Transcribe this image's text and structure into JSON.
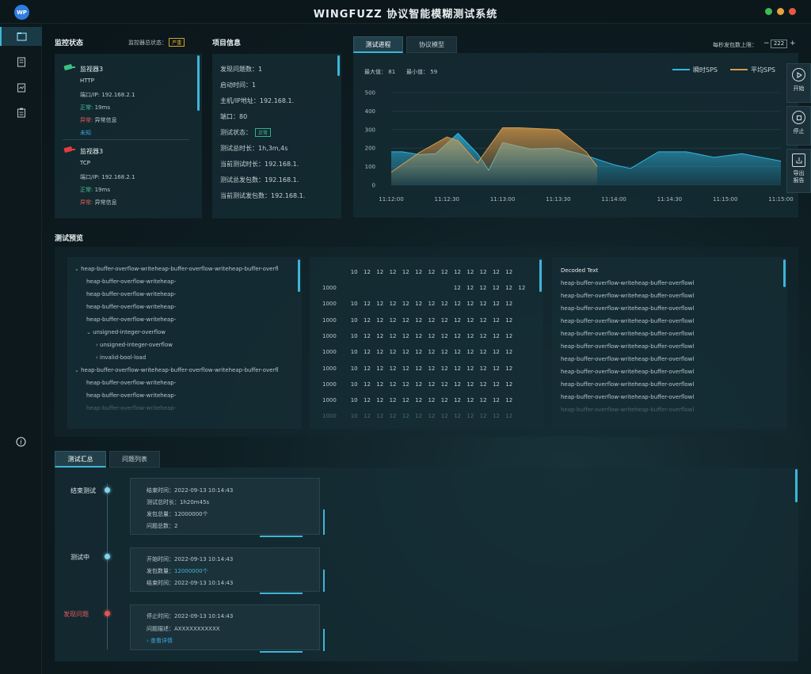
{
  "app": {
    "logo": "WP",
    "title": "WINGFUZZ 协议智能模糊测试系统"
  },
  "monitor": {
    "title": "监控状态",
    "total_status_label": "监控器总状态：",
    "total_status_badge": "严重",
    "items": [
      {
        "name": "监视器3",
        "protocol": "HTTP",
        "addr_label": "端口/IP:",
        "addr": "192.168.2.1",
        "normal_label": "正常:",
        "normal_value": "19ms",
        "error_label": "异常:",
        "error_value": "异常信息",
        "unknown": "未知",
        "icon_color": "#3fbf7f"
      },
      {
        "name": "监视器3",
        "protocol": "TCP",
        "addr_label": "端口/IP:",
        "addr": "192.168.2.1",
        "normal_label": "正常:",
        "normal_value": "19ms",
        "error_label": "异常:",
        "error_value": "异常信息",
        "icon_color": "#e03d3d"
      }
    ]
  },
  "project": {
    "title": "项目信息",
    "rows": [
      "发现问题数：1",
      "启动时间：1",
      "主机/IP地址：192.168.1.",
      "端口：80",
      "测试状态：",
      "测试总时长：1h,3m,4s",
      "当前测试时长：192.168.1.",
      "测试总发包数：192.168.1.",
      "当前测试发包数：192.168.1."
    ],
    "status_badge": "正常"
  },
  "chart_tabs": {
    "progress": "测试进程",
    "model": "协议模型",
    "limit_label": "每秒发包数上限：",
    "limit_value": "222",
    "minus": "−",
    "plus": "+"
  },
  "chart_data": {
    "type": "area",
    "max_label": "最大值：",
    "max_value": "81",
    "min_label": "最小值：",
    "min_value": "59",
    "x": [
      "11:12:00",
      "11:12:30",
      "11:13:00",
      "11:13:30",
      "11:14:00",
      "11:14:30",
      "11:15:00",
      "11:15:00"
    ],
    "ylim": [
      0,
      500
    ],
    "yticks": [
      "500",
      "400",
      "300",
      "200",
      "100",
      "0"
    ],
    "grid": true,
    "legend_position": "top-right",
    "series": [
      {
        "name": "瞬时SPS",
        "color": "#2fb6e0",
        "x": [
          0,
          0.2,
          0.5,
          0.8,
          1.2,
          1.55,
          1.75,
          2,
          2.5,
          3,
          3.5,
          4,
          4.3,
          4.8,
          5.3,
          5.8,
          6.3,
          7
        ],
        "values": [
          180,
          180,
          165,
          170,
          280,
          170,
          80,
          230,
          195,
          200,
          160,
          110,
          90,
          180,
          180,
          150,
          170,
          130
        ]
      },
      {
        "name": "平均SPS",
        "color": "#d99a4a",
        "x": [
          0,
          0.5,
          1,
          1.2,
          1.55,
          2,
          2.3,
          3,
          3.5,
          3.7
        ],
        "values": [
          70,
          175,
          260,
          240,
          120,
          310,
          310,
          300,
          180,
          100
        ]
      }
    ]
  },
  "preview": {
    "title": "测试预览",
    "tree": [
      {
        "text": "heap-buffer-overflow-writeheap-buffer-overflow-writeheap-buffer-overfl",
        "indent": 0,
        "arrow": "v"
      },
      {
        "text": "heap-buffer-overflow-writeheap-",
        "indent": 1,
        "arrow": ""
      },
      {
        "text": "heap-buffer-overflow-writeheap-",
        "indent": 1,
        "arrow": ""
      },
      {
        "text": "heap-buffer-overflow-writeheap-",
        "indent": 1,
        "arrow": ""
      },
      {
        "text": "heap-buffer-overflow-writeheap-",
        "indent": 1,
        "arrow": ""
      },
      {
        "text": "unsigned-integer-overflow",
        "indent": 1,
        "arrow": "v"
      },
      {
        "text": "unsigned-integer-overflow",
        "indent": 2,
        "arrow": ">"
      },
      {
        "text": "invalid-bool-load",
        "indent": 2,
        "arrow": ">"
      },
      {
        "text": "heap-buffer-overflow-writeheap-buffer-overflow-writeheap-buffer-overfl",
        "indent": 0,
        "arrow": "v"
      },
      {
        "text": "heap-buffer-overflow-writeheap-",
        "indent": 1,
        "arrow": ""
      },
      {
        "text": "heap-buffer-overflow-writeheap-",
        "indent": 1,
        "arrow": ""
      },
      {
        "text": "heap-buffer-overflow-writeheap-",
        "indent": 1,
        "arrow": ""
      }
    ],
    "hex_header": [
      "10",
      "12",
      "12",
      "12",
      "12",
      "12",
      "12",
      "12",
      "12",
      "12",
      "12",
      "12",
      "12"
    ],
    "hex_rows": [
      {
        "offset": "1000",
        "cells": [
          "",
          "",
          "",
          "",
          "12",
          "12",
          "12",
          "12",
          "12",
          "12"
        ]
      },
      {
        "offset": "1000",
        "cells": [
          "10",
          "12",
          "12",
          "12",
          "12",
          "12",
          "12",
          "12",
          "12",
          "12",
          "12",
          "12",
          "12"
        ]
      },
      {
        "offset": "1000",
        "cells": [
          "10",
          "12",
          "12",
          "12",
          "12",
          "12",
          "12",
          "12",
          "12",
          "12",
          "12",
          "12",
          "12"
        ]
      },
      {
        "offset": "1000",
        "cells": [
          "10",
          "12",
          "12",
          "12",
          "12",
          "12",
          "12",
          "12",
          "12",
          "12",
          "12",
          "12",
          "12"
        ]
      },
      {
        "offset": "1000",
        "cells": [
          "10",
          "12",
          "12",
          "12",
          "12",
          "12",
          "12",
          "12",
          "12",
          "12",
          "12",
          "12",
          "12"
        ]
      },
      {
        "offset": "1000",
        "cells": [
          "10",
          "12",
          "12",
          "12",
          "12",
          "12",
          "12",
          "12",
          "12",
          "12",
          "12",
          "12",
          "12"
        ]
      },
      {
        "offset": "1000",
        "cells": [
          "10",
          "12",
          "12",
          "12",
          "12",
          "12",
          "12",
          "12",
          "12",
          "12",
          "12",
          "12",
          "12"
        ]
      },
      {
        "offset": "1000",
        "cells": [
          "10",
          "12",
          "12",
          "12",
          "12",
          "12",
          "12",
          "12",
          "12",
          "12",
          "12",
          "12",
          "12"
        ]
      },
      {
        "offset": "1000",
        "cells": [
          "10",
          "12",
          "12",
          "12",
          "12",
          "12",
          "12",
          "12",
          "12",
          "12",
          "12",
          "12",
          "12"
        ]
      }
    ],
    "decoded_title": "Decoded Text",
    "decoded_rows": [
      "heap-buffer-overflow-writeheap-buffer-overflowl",
      "heap-buffer-overflow-writeheap-buffer-overflowl",
      "heap-buffer-overflow-writeheap-buffer-overflowl",
      "heap-buffer-overflow-writeheap-buffer-overflowl",
      "heap-buffer-overflow-writeheap-buffer-overflowl",
      "heap-buffer-overflow-writeheap-buffer-overflowl",
      "heap-buffer-overflow-writeheap-buffer-overflowl",
      "heap-buffer-overflow-writeheap-buffer-overflowl",
      "heap-buffer-overflow-writeheap-buffer-overflowl",
      "heap-buffer-overflow-writeheap-buffer-overflowl",
      "heap-buffer-overflow-writeheap-buffer-overflowl"
    ]
  },
  "summary_tabs": {
    "summary": "测试汇总",
    "issues": "问题列表"
  },
  "timeline": [
    {
      "label": "结束测试",
      "dot": "#7fd4ea",
      "label_color": "#dfe8eb",
      "rows": [
        "结束时间：2022-09-13 10:14:43",
        "测试总时长：1h20m45s",
        "发包总量：12000000个",
        "问题总数：2"
      ]
    },
    {
      "label": "测试中",
      "dot": "#7fd4ea",
      "label_color": "#dfe8eb",
      "rows": [
        "开始时间：2022-09-13 10:14:43",
        "发包数量：",
        "结束时间：2022-09-13 10:14:43"
      ],
      "highlight": "12000000个"
    },
    {
      "label": "发现问题",
      "dot": "#e05555",
      "label_color": "#e25b5b",
      "rows": [
        "停止时间：2022-09-13 10:14:43",
        "问题描述：AXXXXXXXXXXX"
      ],
      "link": "查看详情"
    }
  ],
  "actions": {
    "start": "开始",
    "stop": "停止",
    "export": "导出报告"
  },
  "colors": {
    "accent": "#3fb5d9",
    "warn": "#e0b034",
    "ok": "#47c79a",
    "error": "#e25b5b"
  }
}
